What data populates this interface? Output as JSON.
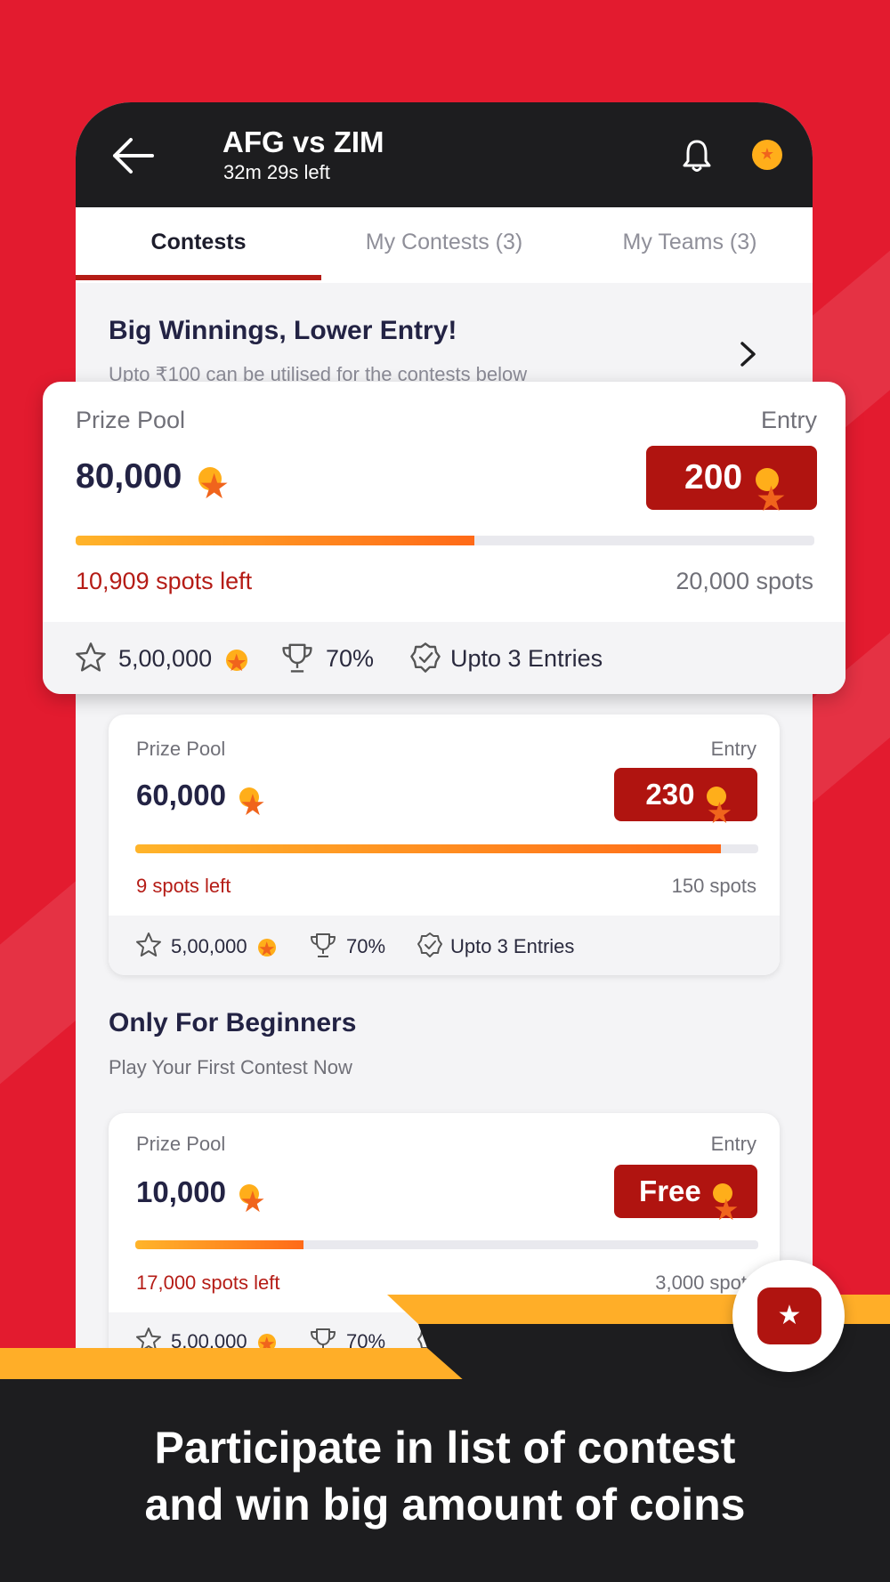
{
  "header": {
    "match_title": "AFG vs ZIM",
    "time_left": "32m 29s left"
  },
  "tabs": [
    {
      "label": "Contests",
      "active": true
    },
    {
      "label": "My Contests (3)",
      "active": false
    },
    {
      "label": "My Teams (3)",
      "active": false
    }
  ],
  "banner": {
    "title": "Big Winnings, Lower Entry!",
    "subtitle": "Upto ₹100 can be utilised for the contests below"
  },
  "contests": [
    {
      "prize_pool_label": "Prize Pool",
      "prize_pool": "80,000",
      "entry_label": "Entry",
      "entry": "200",
      "fill_fraction": 0.54,
      "spots_left": "10,909 spots left",
      "spots_total": "20,000 spots",
      "first_prize": "5,00,000",
      "win_percent": "70%",
      "entries": "Upto 3 Entries"
    },
    {
      "prize_pool_label": "Prize Pool",
      "prize_pool": "60,000",
      "entry_label": "Entry",
      "entry": "230",
      "fill_fraction": 0.94,
      "spots_left": "9 spots left",
      "spots_total": "150 spots",
      "first_prize": "5,00,000",
      "win_percent": "70%",
      "entries": "Upto 3 Entries"
    },
    {
      "prize_pool_label": "Prize Pool",
      "prize_pool": "10,000",
      "entry_label": "Entry",
      "entry": "Free",
      "fill_fraction": 0.27,
      "spots_left": "17,000 spots left",
      "spots_total": "3,000 spots",
      "first_prize": "5,00,000",
      "win_percent": "70%",
      "entries": ""
    }
  ],
  "beginners": {
    "title": "Only For Beginners",
    "subtitle": "Play Your First Contest Now"
  },
  "caption": {
    "line1": "Participate in list of contest",
    "line2": "and win big amount of coins"
  },
  "icons": {
    "back": "arrow-left-icon",
    "notifications": "bell-icon",
    "wallet": "coin-icon",
    "first_prize": "star-icon",
    "winners": "trophy-icon",
    "entries": "verified-badge-icon",
    "fab": "ticket-star-icon"
  },
  "colors": {
    "background": "#e31b2f",
    "header": "#1d1d1f",
    "entry_button": "#b01410",
    "spots_left": "#b51c16",
    "accent_orange": "#ffae28",
    "coin": "#ffae1a"
  }
}
